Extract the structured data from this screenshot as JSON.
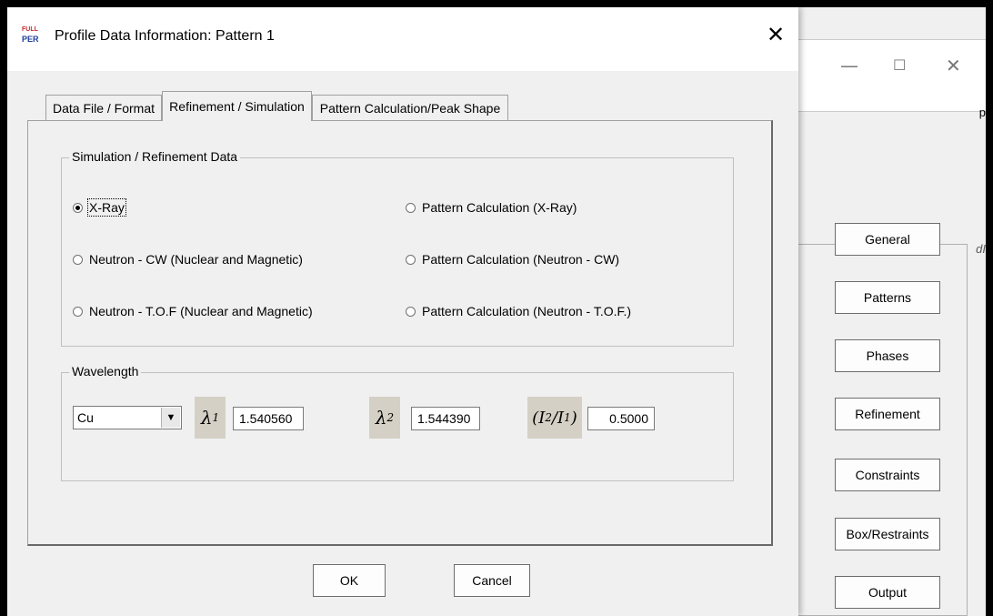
{
  "dialog": {
    "title": "Profile Data Information: Pattern 1",
    "icon_text_top": "FULL",
    "icon_text_bottom": "PER",
    "close_glyph": "✕",
    "tabs": [
      {
        "label": "Data File / Format",
        "active": false
      },
      {
        "label": "Refinement / Simulation",
        "active": true
      },
      {
        "label": "Pattern Calculation/Peak Shape",
        "active": false
      }
    ],
    "sim_group_title": "Simulation / Refinement Data",
    "radios": [
      {
        "label": "X-Ray",
        "checked": true
      },
      {
        "label": "Pattern Calculation (X-Ray)",
        "checked": false
      },
      {
        "label": "Neutron - CW (Nuclear and Magnetic)",
        "checked": false
      },
      {
        "label": "Pattern Calculation (Neutron - CW)",
        "checked": false
      },
      {
        "label": "Neutron - T.O.F (Nuclear and Magnetic)",
        "checked": false
      },
      {
        "label": "Pattern Calculation (Neutron - T.O.F.)",
        "checked": false
      }
    ],
    "wavelength": {
      "group_title": "Wavelength",
      "anode": "Cu",
      "lambda1_symbol": "λ",
      "lambda1_sub": "1",
      "lambda1_value": "1.540560",
      "lambda2_symbol": "λ",
      "lambda2_sub": "2",
      "lambda2_value": "1.544390",
      "ratio_symbol_a": "(I",
      "ratio_sub_a": "2",
      "ratio_symbol_b": "/I",
      "ratio_sub_b": "1",
      "ratio_symbol_c": ")",
      "ratio_value": "0.5000"
    },
    "ok_label": "OK",
    "cancel_label": "Cancel"
  },
  "main_window": {
    "minimize_glyph": "—",
    "maximize_glyph": "☐",
    "close_glyph": "✕",
    "edge_text_p": "p",
    "edge_text_d": "dI",
    "buttons": [
      "General",
      "Patterns",
      "Phases",
      "Refinement",
      "Constraints",
      "Box/Restraints",
      "Output"
    ]
  },
  "colors": {
    "dialog_bg": "#f0f0f0",
    "symbol_bg": "#d5d0c5",
    "outer_border": "#000000"
  }
}
